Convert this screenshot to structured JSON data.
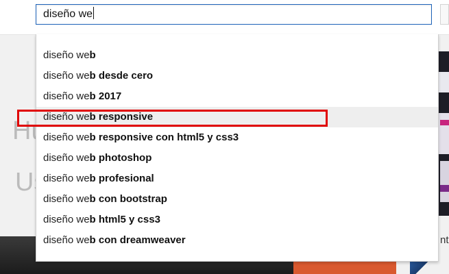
{
  "search": {
    "value": "diseño we"
  },
  "background": {
    "hero_fragment_1": "Hu",
    "hero_fragment_2": "Us",
    "side_fragment": "nt"
  },
  "suggestions": [
    {
      "typed": "diseño we",
      "completion": "b",
      "highlighted": false
    },
    {
      "typed": "diseño we",
      "completion": "b desde cero",
      "highlighted": false
    },
    {
      "typed": "diseño we",
      "completion": "b 2017",
      "highlighted": false
    },
    {
      "typed": "diseño we",
      "completion": "b responsive",
      "highlighted": true
    },
    {
      "typed": "diseño we",
      "completion": "b responsive con html5 y css3",
      "highlighted": false
    },
    {
      "typed": "diseño we",
      "completion": "b photoshop",
      "highlighted": false
    },
    {
      "typed": "diseño we",
      "completion": "b profesional",
      "highlighted": false
    },
    {
      "typed": "diseño we",
      "completion": "b con bootstrap",
      "highlighted": false
    },
    {
      "typed": "diseño we",
      "completion": "b html5 y css3",
      "highlighted": false
    },
    {
      "typed": "diseño we",
      "completion": "b con dreamweaver",
      "highlighted": false
    }
  ],
  "colors": {
    "input_border": "#1c62b9",
    "highlight_row": "#eeeeee",
    "annotation_box": "#e00000"
  }
}
